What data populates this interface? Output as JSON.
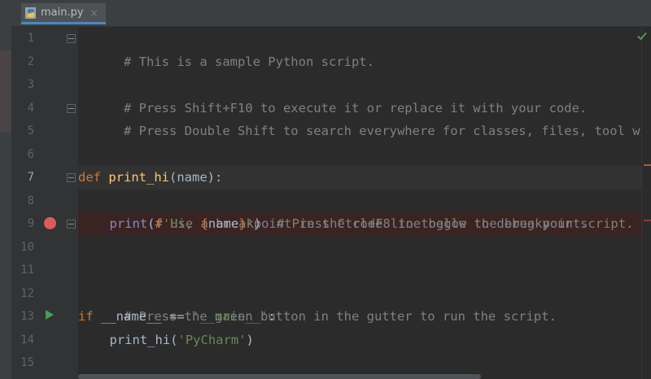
{
  "tab": {
    "label": "main.py",
    "close_glyph": "×",
    "icon": "python-file-icon"
  },
  "gutter": {
    "line_numbers": [
      "1",
      "2",
      "3",
      "4",
      "5",
      "6",
      "7",
      "8",
      "9",
      "10",
      "11",
      "12",
      "13",
      "14",
      "15"
    ],
    "active_line": "7",
    "breakpoint_line": "9",
    "run_line": "13"
  },
  "code": {
    "line1": "# This is a sample Python script.",
    "line3": "# Press Shift+F10 to execute it or replace it with your code.",
    "line4": "# Press Double Shift to search everywhere for classes, files, tool windows",
    "line7": {
      "kw": "def",
      "sp": " ",
      "fn": "print_hi",
      "rest": "(name):"
    },
    "line8": "# Use a breakpoint in the code line below to debug your script.",
    "line9": {
      "fn": "print",
      "open": "(",
      "prefix": "f",
      "str_open": "'Hi, ",
      "brace_open": "{",
      "var": "name",
      "brace_close": "}",
      "str_close": "'",
      "close": ")",
      "comment": "# Press Ctrl+F8 to toggle the breakpoint."
    },
    "line12": "# Press the green button in the gutter to run the script.",
    "line13": {
      "kw": "if",
      "mid": " __name__ == ",
      "str": "'__main__'",
      "end": ":"
    },
    "line14": {
      "fn": "print_hi",
      "open": "(",
      "str": "'PyCharm'",
      "close": ")"
    }
  },
  "colors": {
    "background": "#2b2b2b",
    "comment": "#808080",
    "keyword": "#cc7832",
    "function": "#ffc66d",
    "string": "#6a8759",
    "breakpoint": "#db5c5c",
    "run": "#499c54",
    "inspection_ok": "#499c54"
  },
  "indicators": {
    "inspection_icon": "check-icon"
  }
}
